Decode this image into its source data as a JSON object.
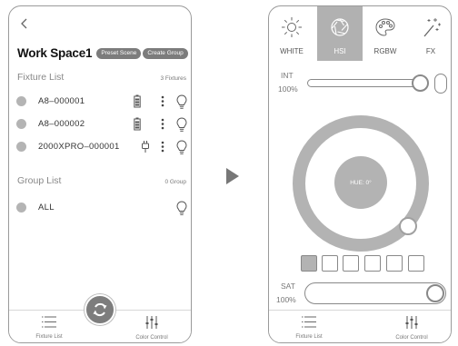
{
  "left_screen": {
    "workspace_title": "Work Space1",
    "preset_scene_label": "Preset Scene",
    "create_group_label": "Create Group",
    "fixture_list_label": "Fixture List",
    "fixture_count": "3 Fixtures",
    "fixtures": [
      {
        "name": "A8–000001",
        "status_icon": "battery-icon"
      },
      {
        "name": "A8–000002",
        "status_icon": "battery-icon"
      },
      {
        "name": "2000XPRO–000001",
        "status_icon": "plug-icon"
      }
    ],
    "group_list_label": "Group List",
    "group_count": "0 Group",
    "groups": [
      {
        "name": "ALL"
      }
    ],
    "bottom_nav": {
      "fixture_list": "Fixture List",
      "color_control": "Color Control"
    }
  },
  "right_screen": {
    "tabs": [
      {
        "label": "WHITE",
        "icon": "sun-icon"
      },
      {
        "label": "HSI",
        "icon": "aperture-icon",
        "active": true
      },
      {
        "label": "RGBW",
        "icon": "palette-icon"
      },
      {
        "label": "FX",
        "icon": "magic-wand-icon"
      }
    ],
    "int_label": "INT",
    "int_value": "100%",
    "hue_label": "HUE: 0°",
    "sat_label": "SAT",
    "sat_value": "100%",
    "bottom_nav": {
      "fixture_list": "Fixture List",
      "color_control": "Color Control"
    }
  },
  "colors": {
    "accent_gray": "#7d7d7d",
    "light_gray": "#b3b3b3",
    "border": "#9a9a9a"
  }
}
